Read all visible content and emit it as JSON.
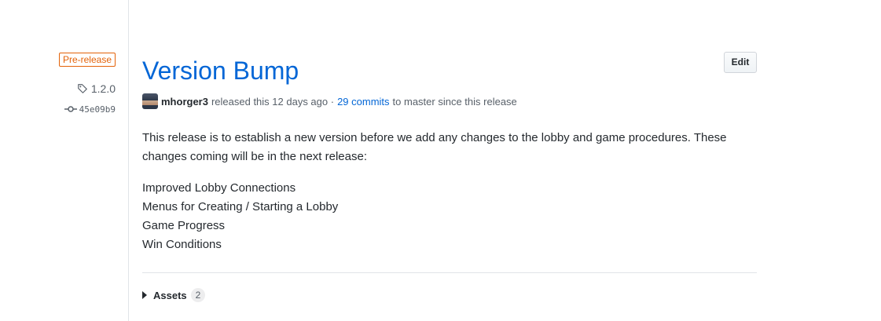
{
  "sidebar": {
    "badge": "Pre-release",
    "tag": "1.2.0",
    "tag_icon": "tag-icon",
    "commit": "45e09b9",
    "commit_icon": "git-commit-icon"
  },
  "release": {
    "title": "Version Bump",
    "edit_label": "Edit",
    "author": "mhorger3",
    "released_text": "released this 12 days ago ·",
    "commits_link": "29 commits",
    "commits_suffix": "to master since this release",
    "body_paragraph": "This release is to establish a new version before we add any changes to the lobby and game procedures. These changes coming will be in the next release:",
    "changes": [
      "Improved Lobby Connections",
      "Menus for Creating / Starting a Lobby",
      "Game Progress",
      "Win Conditions"
    ],
    "assets_label": "Assets",
    "assets_count": "2"
  },
  "colors": {
    "link": "#0366d6",
    "prerelease": "#e36209",
    "text": "#24292e",
    "muted": "#586069"
  }
}
